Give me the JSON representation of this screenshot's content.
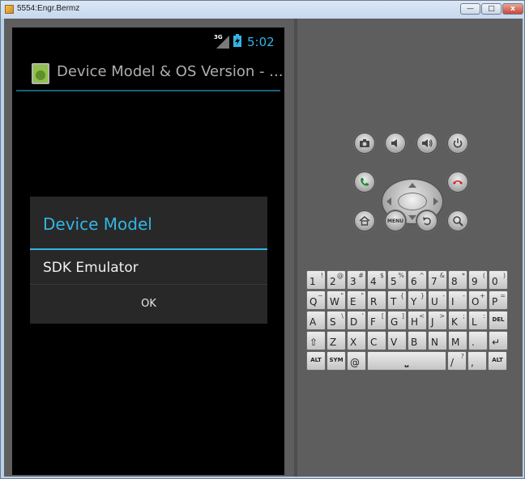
{
  "window": {
    "title": "5554:Engr.Bermz",
    "minimize": "—",
    "maximize": "□",
    "close": "x"
  },
  "status": {
    "network": "3G",
    "time": "5:02"
  },
  "app": {
    "title": "Device Model & OS Version - ..."
  },
  "dialog": {
    "title": "Device Model",
    "message": "SDK Emulator",
    "ok": "OK"
  },
  "hardware_buttons": [
    "camera",
    "volume-down",
    "volume-up",
    "power",
    "call",
    "end-call",
    "home",
    "MENU",
    "back",
    "search"
  ],
  "keyboard": {
    "rows": [
      [
        [
          "1",
          "!"
        ],
        [
          "2",
          "@"
        ],
        [
          "3",
          "#"
        ],
        [
          "4",
          "$"
        ],
        [
          "5",
          "%"
        ],
        [
          "6",
          "^"
        ],
        [
          "7",
          "&"
        ],
        [
          "8",
          "*"
        ],
        [
          "9",
          "("
        ],
        [
          "0",
          ")"
        ]
      ],
      [
        [
          "Q",
          "~"
        ],
        [
          "W",
          "\""
        ],
        [
          "E",
          "\""
        ],
        [
          "R",
          ""
        ],
        [
          "T",
          "{"
        ],
        [
          "Y",
          "}"
        ],
        [
          "U",
          "-"
        ],
        [
          "I",
          "-"
        ],
        [
          "O",
          "+"
        ],
        [
          "P",
          "="
        ]
      ],
      [
        [
          "A",
          ""
        ],
        [
          "S",
          "\\"
        ],
        [
          "D",
          "'"
        ],
        [
          "F",
          "["
        ],
        [
          "G",
          "]"
        ],
        [
          "H",
          "<"
        ],
        [
          "J",
          ">"
        ],
        [
          "K",
          ";"
        ],
        [
          "L",
          ":"
        ],
        [
          "DEL",
          ""
        ]
      ],
      [
        [
          "⇧",
          ""
        ],
        [
          "Z",
          ""
        ],
        [
          "X",
          ""
        ],
        [
          "C",
          ""
        ],
        [
          "V",
          ""
        ],
        [
          "B",
          ""
        ],
        [
          "N",
          ""
        ],
        [
          "M",
          ""
        ],
        [
          ".",
          ""
        ],
        [
          "↵",
          ""
        ]
      ],
      [
        [
          "ALT",
          ""
        ],
        [
          "SYM",
          ""
        ],
        [
          "@",
          ""
        ],
        [
          "SPACE",
          ""
        ],
        [
          "/",
          "?"
        ],
        [
          ",",
          ""
        ],
        [
          "ALT",
          ""
        ]
      ]
    ]
  }
}
